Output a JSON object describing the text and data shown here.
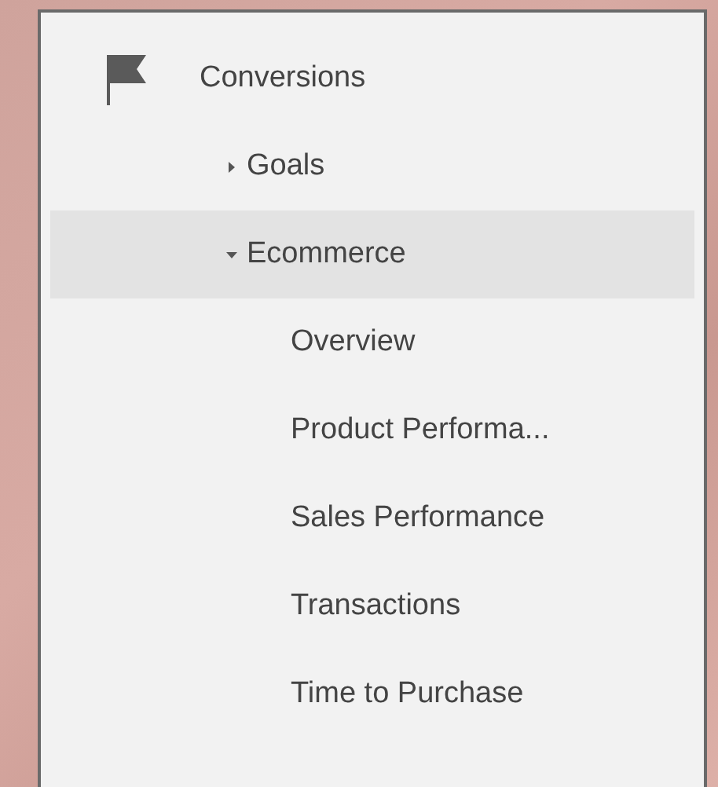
{
  "section": {
    "title": "Conversions",
    "items": [
      {
        "label": "Goals",
        "expanded": false,
        "selected": false
      },
      {
        "label": "Ecommerce",
        "expanded": true,
        "selected": true,
        "children": [
          {
            "label": "Overview",
            "selected": false
          },
          {
            "label": "Product Performa...",
            "selected": false
          },
          {
            "label": "Sales Performance",
            "selected": false
          },
          {
            "label": "Transactions",
            "selected": false
          },
          {
            "label": "Time to Purchase",
            "selected": false
          }
        ]
      }
    ]
  }
}
